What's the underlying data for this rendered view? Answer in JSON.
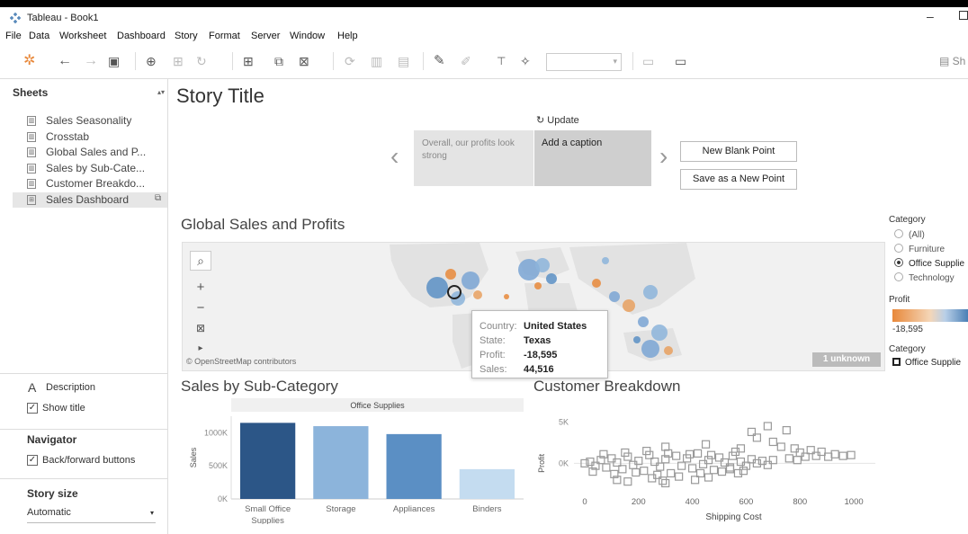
{
  "window": {
    "title": "Tableau - Book1",
    "minimize": "–"
  },
  "menu": [
    "File",
    "Data",
    "Worksheet",
    "Dashboard",
    "Story",
    "Format",
    "Server",
    "Window",
    "Help"
  ],
  "toolbar": {
    "show_me": "Sh"
  },
  "sidebar": {
    "header": "Sheets",
    "sheets": [
      {
        "label": "Sales Seasonality",
        "icon": "worksheet-icon"
      },
      {
        "label": "Crosstab",
        "icon": "worksheet-icon"
      },
      {
        "label": "Global Sales and P...",
        "icon": "worksheet-icon"
      },
      {
        "label": "Sales by Sub-Cate...",
        "icon": "worksheet-icon"
      },
      {
        "label": "Customer Breakdo...",
        "icon": "worksheet-icon"
      },
      {
        "label": "Sales Dashboard",
        "icon": "dashboard-icon",
        "active": true
      }
    ],
    "description_label": "Description",
    "show_title_label": "Show title",
    "navigator_header": "Navigator",
    "back_forward_label": "Back/forward buttons",
    "story_size_header": "Story size",
    "story_size_value": "Automatic"
  },
  "story": {
    "title": "Story Title",
    "update_label": "Update",
    "caption_prev": "Overall, our profits look strong",
    "caption_current": "Add a caption",
    "new_blank_point": "New Blank Point",
    "save_as_new_point": "Save as a New Point"
  },
  "map": {
    "title": "Global Sales and Profits",
    "attribution": "© OpenStreetMap contributors",
    "unknown_badge": "1 unknown",
    "tooltip": {
      "country_label": "Country:",
      "country": "United States",
      "state_label": "State:",
      "state": "Texas",
      "profit_label": "Profit:",
      "profit": "-18,595",
      "sales_label": "Sales:",
      "sales": "44,516"
    }
  },
  "legend": {
    "category_title": "Category",
    "options": [
      "(All)",
      "Furniture",
      "Office Supplie",
      "Technology"
    ],
    "selected": "Office Supplie",
    "profit_title": "Profit",
    "profit_min": "-18,595",
    "category_title2": "Category",
    "category_item": "Office Supplie",
    "colors": {
      "negative": "#e8883a",
      "positive": "#4a7fb5"
    }
  },
  "bar_chart_title": "Sales by Sub-Category",
  "scatter_chart_title": "Customer Breakdown",
  "chart_data": [
    {
      "type": "bar",
      "header": "Office Supplies",
      "ylabel": "Sales",
      "yticks": [
        "0K",
        "500K",
        "1000K"
      ],
      "ylim": [
        0,
        1250
      ],
      "categories": [
        "Small Office Supplies",
        "Storage",
        "Appliances",
        "Binders"
      ],
      "category_lines": [
        [
          "Small Office",
          "Supplies"
        ],
        [
          "Storage"
        ],
        [
          "Appliances"
        ],
        [
          "Binders"
        ]
      ],
      "values": [
        1150,
        1100,
        980,
        450
      ],
      "colors": [
        "#2c5687",
        "#8cb4db",
        "#5b8fc4",
        "#c4dcf0"
      ]
    },
    {
      "type": "scatter",
      "xlabel": "Shipping Cost",
      "ylabel": "Profit",
      "xticks": [
        0,
        200,
        400,
        600,
        800,
        1000
      ],
      "yticks": [
        "5K",
        "0K"
      ],
      "xlim": [
        -40,
        1080
      ],
      "ylim": [
        -3,
        7
      ],
      "points": [
        [
          0,
          0
        ],
        [
          20,
          0.2
        ],
        [
          40,
          -0.3
        ],
        [
          60,
          0.4
        ],
        [
          80,
          -0.5
        ],
        [
          100,
          0.6
        ],
        [
          120,
          0.1
        ],
        [
          140,
          -0.7
        ],
        [
          160,
          0.8
        ],
        [
          180,
          -0.2
        ],
        [
          200,
          0.3
        ],
        [
          220,
          -0.9
        ],
        [
          240,
          1.0
        ],
        [
          260,
          0.2
        ],
        [
          280,
          -0.4
        ],
        [
          300,
          0.5
        ],
        [
          320,
          -1.2
        ],
        [
          340,
          0.9
        ],
        [
          360,
          -0.3
        ],
        [
          380,
          0.6
        ],
        [
          400,
          -0.6
        ],
        [
          420,
          1.2
        ],
        [
          440,
          -0.1
        ],
        [
          460,
          0.4
        ],
        [
          480,
          -0.8
        ],
        [
          500,
          0.7
        ],
        [
          520,
          0.1
        ],
        [
          540,
          -0.5
        ],
        [
          560,
          1.4
        ],
        [
          580,
          0.2
        ],
        [
          600,
          -0.3
        ],
        [
          620,
          0.5
        ],
        [
          640,
          0.0
        ],
        [
          660,
          0.3
        ],
        [
          680,
          -0.2
        ],
        [
          700,
          0.4
        ],
        [
          30,
          -1.0
        ],
        [
          70,
          1.1
        ],
        [
          110,
          -1.3
        ],
        [
          150,
          1.3
        ],
        [
          190,
          -1.1
        ],
        [
          230,
          1.5
        ],
        [
          270,
          -1.4
        ],
        [
          310,
          1.2
        ],
        [
          350,
          -1.6
        ],
        [
          390,
          1.1
        ],
        [
          430,
          -1.2
        ],
        [
          470,
          1.0
        ],
        [
          510,
          -1.0
        ],
        [
          550,
          0.9
        ],
        [
          590,
          -0.9
        ],
        [
          120,
          -2.0
        ],
        [
          160,
          -2.2
        ],
        [
          250,
          -1.8
        ],
        [
          290,
          -2.1
        ],
        [
          410,
          -2.0
        ],
        [
          460,
          -1.7
        ],
        [
          300,
          2.0
        ],
        [
          450,
          2.3
        ],
        [
          580,
          1.8
        ],
        [
          620,
          3.8
        ],
        [
          640,
          3.1
        ],
        [
          680,
          4.5
        ],
        [
          700,
          2.6
        ],
        [
          730,
          2.0
        ],
        [
          750,
          4.0
        ],
        [
          780,
          1.8
        ],
        [
          800,
          1.3
        ],
        [
          820,
          0.8
        ],
        [
          840,
          1.6
        ],
        [
          860,
          0.9
        ],
        [
          880,
          1.4
        ],
        [
          905,
          0.8
        ],
        [
          930,
          1.1
        ],
        [
          960,
          0.9
        ],
        [
          990,
          1.0
        ],
        [
          540,
          -0.7
        ],
        [
          570,
          -1.2
        ],
        [
          760,
          0.6
        ],
        [
          790,
          0.4
        ],
        [
          300,
          -2.4
        ]
      ]
    }
  ]
}
